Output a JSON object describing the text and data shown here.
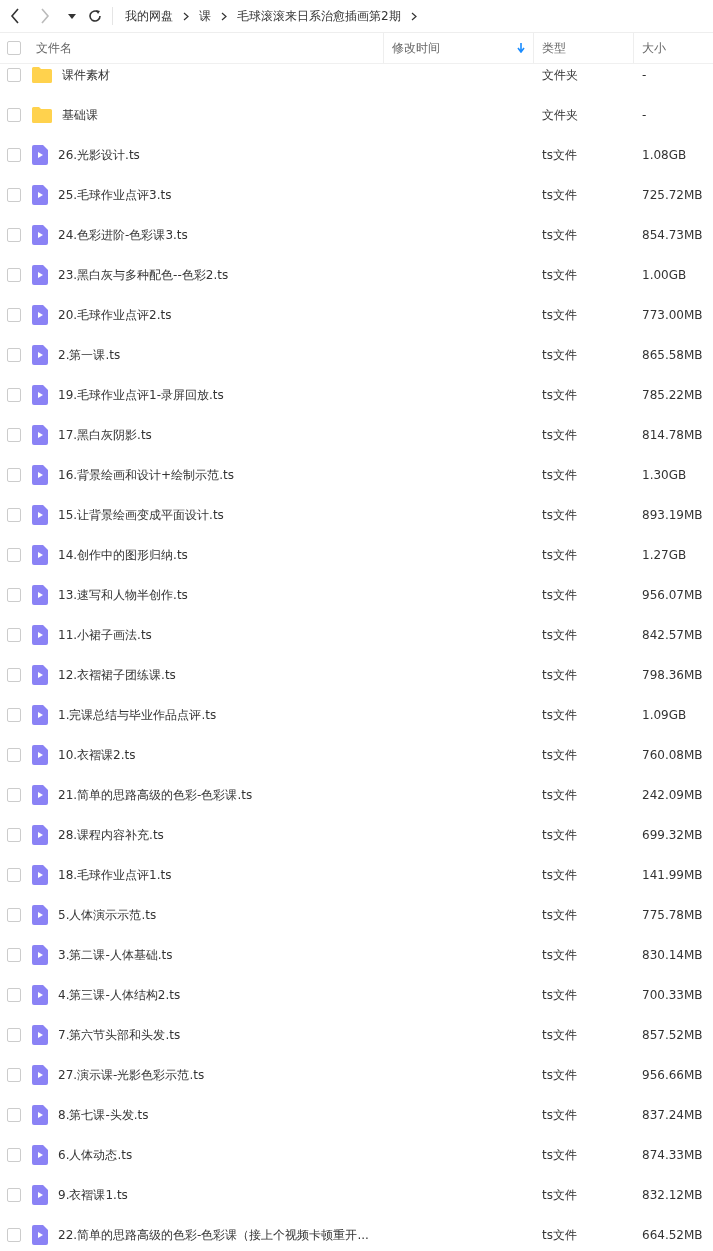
{
  "toolbar": {
    "back_disabled": false,
    "forward_disabled": true
  },
  "breadcrumb": [
    "我的网盘",
    "课",
    "毛球滚滚来日系治愈插画第2期"
  ],
  "header": {
    "checked": false,
    "columns": [
      {
        "label": "文件名",
        "sorted": false
      },
      {
        "label": "修改时间",
        "sorted": true
      },
      {
        "label": "类型",
        "sorted": false
      },
      {
        "label": "大小",
        "sorted": false
      }
    ]
  },
  "rows": [
    {
      "kind": "folder",
      "name": "课件素材",
      "type": "文件夹",
      "size": "-",
      "checked": false
    },
    {
      "kind": "folder",
      "name": "基础课",
      "type": "文件夹",
      "size": "-",
      "checked": false
    },
    {
      "kind": "video",
      "name": "26.光影设计.ts",
      "type": "ts文件",
      "size": "1.08GB",
      "checked": false
    },
    {
      "kind": "video",
      "name": "25.毛球作业点评3.ts",
      "type": "ts文件",
      "size": "725.72MB",
      "checked": false
    },
    {
      "kind": "video",
      "name": "24.色彩进阶-色彩课3.ts",
      "type": "ts文件",
      "size": "854.73MB",
      "checked": false
    },
    {
      "kind": "video",
      "name": "23.黑白灰与多种配色--色彩2.ts",
      "type": "ts文件",
      "size": "1.00GB",
      "checked": false
    },
    {
      "kind": "video",
      "name": "20.毛球作业点评2.ts",
      "type": "ts文件",
      "size": "773.00MB",
      "checked": false
    },
    {
      "kind": "video",
      "name": "2.第一课.ts",
      "type": "ts文件",
      "size": "865.58MB",
      "checked": false
    },
    {
      "kind": "video",
      "name": "19.毛球作业点评1-录屏回放.ts",
      "type": "ts文件",
      "size": "785.22MB",
      "checked": false
    },
    {
      "kind": "video",
      "name": "17.黑白灰阴影.ts",
      "type": "ts文件",
      "size": "814.78MB",
      "checked": false
    },
    {
      "kind": "video",
      "name": "16.背景绘画和设计+绘制示范.ts",
      "type": "ts文件",
      "size": "1.30GB",
      "checked": false
    },
    {
      "kind": "video",
      "name": "15.让背景绘画变成平面设计.ts",
      "type": "ts文件",
      "size": "893.19MB",
      "checked": false
    },
    {
      "kind": "video",
      "name": "14.创作中的图形归纳.ts",
      "type": "ts文件",
      "size": "1.27GB",
      "checked": false
    },
    {
      "kind": "video",
      "name": "13.速写和人物半创作.ts",
      "type": "ts文件",
      "size": "956.07MB",
      "checked": false
    },
    {
      "kind": "video",
      "name": "11.小裙子画法.ts",
      "type": "ts文件",
      "size": "842.57MB",
      "checked": false
    },
    {
      "kind": "video",
      "name": "12.衣褶裙子团练课.ts",
      "type": "ts文件",
      "size": "798.36MB",
      "checked": false
    },
    {
      "kind": "video",
      "name": "1.完课总结与毕业作品点评.ts",
      "type": "ts文件",
      "size": "1.09GB",
      "checked": false
    },
    {
      "kind": "video",
      "name": "10.衣褶课2.ts",
      "type": "ts文件",
      "size": "760.08MB",
      "checked": false
    },
    {
      "kind": "video",
      "name": "21.简单的思路高级的色彩-色彩课.ts",
      "type": "ts文件",
      "size": "242.09MB",
      "checked": false
    },
    {
      "kind": "video",
      "name": "28.课程内容补充.ts",
      "type": "ts文件",
      "size": "699.32MB",
      "checked": false
    },
    {
      "kind": "video",
      "name": "18.毛球作业点评1.ts",
      "type": "ts文件",
      "size": "141.99MB",
      "checked": false
    },
    {
      "kind": "video",
      "name": "5.人体演示示范.ts",
      "type": "ts文件",
      "size": "775.78MB",
      "checked": false
    },
    {
      "kind": "video",
      "name": "3.第二课-人体基础.ts",
      "type": "ts文件",
      "size": "830.14MB",
      "checked": false
    },
    {
      "kind": "video",
      "name": "4.第三课-人体结构2.ts",
      "type": "ts文件",
      "size": "700.33MB",
      "checked": false
    },
    {
      "kind": "video",
      "name": "7.第六节头部和头发.ts",
      "type": "ts文件",
      "size": "857.52MB",
      "checked": false
    },
    {
      "kind": "video",
      "name": "27.演示课-光影色彩示范.ts",
      "type": "ts文件",
      "size": "956.66MB",
      "checked": false
    },
    {
      "kind": "video",
      "name": "8.第七课-头发.ts",
      "type": "ts文件",
      "size": "837.24MB",
      "checked": false
    },
    {
      "kind": "video",
      "name": "6.人体动态.ts",
      "type": "ts文件",
      "size": "874.33MB",
      "checked": false
    },
    {
      "kind": "video",
      "name": "9.衣褶课1.ts",
      "type": "ts文件",
      "size": "832.12MB",
      "checked": false
    },
    {
      "kind": "video",
      "name": "22.简单的思路高级的色彩-色彩课（接上个视频卡顿重开...",
      "type": "ts文件",
      "size": "664.52MB",
      "checked": false
    }
  ]
}
